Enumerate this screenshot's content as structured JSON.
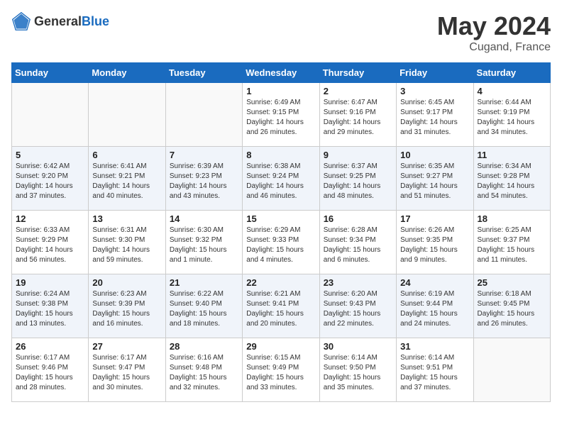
{
  "header": {
    "logo_general": "General",
    "logo_blue": "Blue",
    "month_year": "May 2024",
    "location": "Cugand, France"
  },
  "weekdays": [
    "Sunday",
    "Monday",
    "Tuesday",
    "Wednesday",
    "Thursday",
    "Friday",
    "Saturday"
  ],
  "weeks": [
    [
      {
        "day": "",
        "lines": []
      },
      {
        "day": "",
        "lines": []
      },
      {
        "day": "",
        "lines": []
      },
      {
        "day": "1",
        "lines": [
          "Sunrise: 6:49 AM",
          "Sunset: 9:15 PM",
          "Daylight: 14 hours",
          "and 26 minutes."
        ]
      },
      {
        "day": "2",
        "lines": [
          "Sunrise: 6:47 AM",
          "Sunset: 9:16 PM",
          "Daylight: 14 hours",
          "and 29 minutes."
        ]
      },
      {
        "day": "3",
        "lines": [
          "Sunrise: 6:45 AM",
          "Sunset: 9:17 PM",
          "Daylight: 14 hours",
          "and 31 minutes."
        ]
      },
      {
        "day": "4",
        "lines": [
          "Sunrise: 6:44 AM",
          "Sunset: 9:19 PM",
          "Daylight: 14 hours",
          "and 34 minutes."
        ]
      }
    ],
    [
      {
        "day": "5",
        "lines": [
          "Sunrise: 6:42 AM",
          "Sunset: 9:20 PM",
          "Daylight: 14 hours",
          "and 37 minutes."
        ]
      },
      {
        "day": "6",
        "lines": [
          "Sunrise: 6:41 AM",
          "Sunset: 9:21 PM",
          "Daylight: 14 hours",
          "and 40 minutes."
        ]
      },
      {
        "day": "7",
        "lines": [
          "Sunrise: 6:39 AM",
          "Sunset: 9:23 PM",
          "Daylight: 14 hours",
          "and 43 minutes."
        ]
      },
      {
        "day": "8",
        "lines": [
          "Sunrise: 6:38 AM",
          "Sunset: 9:24 PM",
          "Daylight: 14 hours",
          "and 46 minutes."
        ]
      },
      {
        "day": "9",
        "lines": [
          "Sunrise: 6:37 AM",
          "Sunset: 9:25 PM",
          "Daylight: 14 hours",
          "and 48 minutes."
        ]
      },
      {
        "day": "10",
        "lines": [
          "Sunrise: 6:35 AM",
          "Sunset: 9:27 PM",
          "Daylight: 14 hours",
          "and 51 minutes."
        ]
      },
      {
        "day": "11",
        "lines": [
          "Sunrise: 6:34 AM",
          "Sunset: 9:28 PM",
          "Daylight: 14 hours",
          "and 54 minutes."
        ]
      }
    ],
    [
      {
        "day": "12",
        "lines": [
          "Sunrise: 6:33 AM",
          "Sunset: 9:29 PM",
          "Daylight: 14 hours",
          "and 56 minutes."
        ]
      },
      {
        "day": "13",
        "lines": [
          "Sunrise: 6:31 AM",
          "Sunset: 9:30 PM",
          "Daylight: 14 hours",
          "and 59 minutes."
        ]
      },
      {
        "day": "14",
        "lines": [
          "Sunrise: 6:30 AM",
          "Sunset: 9:32 PM",
          "Daylight: 15 hours",
          "and 1 minute."
        ]
      },
      {
        "day": "15",
        "lines": [
          "Sunrise: 6:29 AM",
          "Sunset: 9:33 PM",
          "Daylight: 15 hours",
          "and 4 minutes."
        ]
      },
      {
        "day": "16",
        "lines": [
          "Sunrise: 6:28 AM",
          "Sunset: 9:34 PM",
          "Daylight: 15 hours",
          "and 6 minutes."
        ]
      },
      {
        "day": "17",
        "lines": [
          "Sunrise: 6:26 AM",
          "Sunset: 9:35 PM",
          "Daylight: 15 hours",
          "and 9 minutes."
        ]
      },
      {
        "day": "18",
        "lines": [
          "Sunrise: 6:25 AM",
          "Sunset: 9:37 PM",
          "Daylight: 15 hours",
          "and 11 minutes."
        ]
      }
    ],
    [
      {
        "day": "19",
        "lines": [
          "Sunrise: 6:24 AM",
          "Sunset: 9:38 PM",
          "Daylight: 15 hours",
          "and 13 minutes."
        ]
      },
      {
        "day": "20",
        "lines": [
          "Sunrise: 6:23 AM",
          "Sunset: 9:39 PM",
          "Daylight: 15 hours",
          "and 16 minutes."
        ]
      },
      {
        "day": "21",
        "lines": [
          "Sunrise: 6:22 AM",
          "Sunset: 9:40 PM",
          "Daylight: 15 hours",
          "and 18 minutes."
        ]
      },
      {
        "day": "22",
        "lines": [
          "Sunrise: 6:21 AM",
          "Sunset: 9:41 PM",
          "Daylight: 15 hours",
          "and 20 minutes."
        ]
      },
      {
        "day": "23",
        "lines": [
          "Sunrise: 6:20 AM",
          "Sunset: 9:43 PM",
          "Daylight: 15 hours",
          "and 22 minutes."
        ]
      },
      {
        "day": "24",
        "lines": [
          "Sunrise: 6:19 AM",
          "Sunset: 9:44 PM",
          "Daylight: 15 hours",
          "and 24 minutes."
        ]
      },
      {
        "day": "25",
        "lines": [
          "Sunrise: 6:18 AM",
          "Sunset: 9:45 PM",
          "Daylight: 15 hours",
          "and 26 minutes."
        ]
      }
    ],
    [
      {
        "day": "26",
        "lines": [
          "Sunrise: 6:17 AM",
          "Sunset: 9:46 PM",
          "Daylight: 15 hours",
          "and 28 minutes."
        ]
      },
      {
        "day": "27",
        "lines": [
          "Sunrise: 6:17 AM",
          "Sunset: 9:47 PM",
          "Daylight: 15 hours",
          "and 30 minutes."
        ]
      },
      {
        "day": "28",
        "lines": [
          "Sunrise: 6:16 AM",
          "Sunset: 9:48 PM",
          "Daylight: 15 hours",
          "and 32 minutes."
        ]
      },
      {
        "day": "29",
        "lines": [
          "Sunrise: 6:15 AM",
          "Sunset: 9:49 PM",
          "Daylight: 15 hours",
          "and 33 minutes."
        ]
      },
      {
        "day": "30",
        "lines": [
          "Sunrise: 6:14 AM",
          "Sunset: 9:50 PM",
          "Daylight: 15 hours",
          "and 35 minutes."
        ]
      },
      {
        "day": "31",
        "lines": [
          "Sunrise: 6:14 AM",
          "Sunset: 9:51 PM",
          "Daylight: 15 hours",
          "and 37 minutes."
        ]
      },
      {
        "day": "",
        "lines": []
      }
    ]
  ]
}
